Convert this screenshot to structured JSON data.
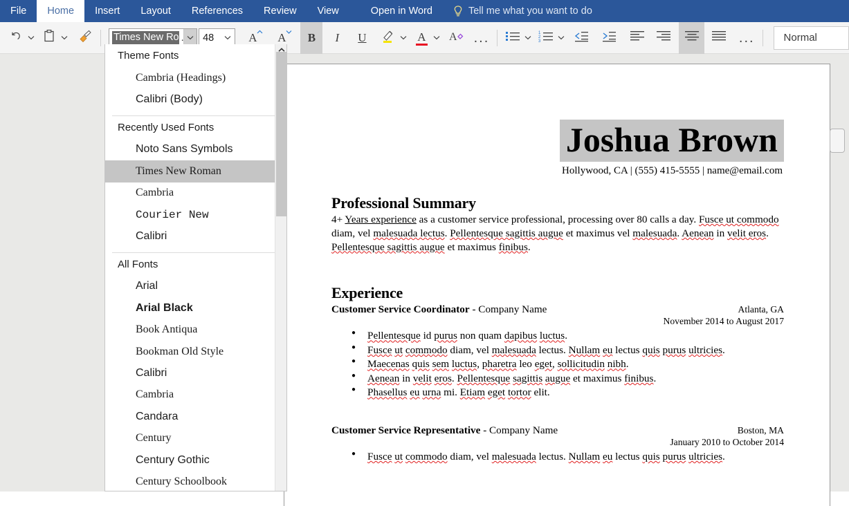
{
  "ribbon": {
    "tabs": [
      {
        "label": "File",
        "active": false
      },
      {
        "label": "Home",
        "active": true
      },
      {
        "label": "Insert",
        "active": false
      },
      {
        "label": "Layout",
        "active": false
      },
      {
        "label": "References",
        "active": false
      },
      {
        "label": "Review",
        "active": false
      },
      {
        "label": "View",
        "active": false
      },
      {
        "label": "Open in Word",
        "active": false
      }
    ],
    "tell_me": "Tell me what you want to do",
    "tell_me_icon": "lightbulb-icon"
  },
  "toolbar": {
    "undo_label": "undo-icon",
    "paste_label": "paste-icon",
    "format_painter_label": "format-painter-icon",
    "font_name": {
      "value_visible": "Times New Ro",
      "ellipsis": "...",
      "full_value": "Times New Roman"
    },
    "font_size": {
      "value": "48"
    },
    "grow_font": "A",
    "shrink_font": "A",
    "bold": "B",
    "italic": "I",
    "underline": "U",
    "highlight": "highlight-icon",
    "font_color": "A",
    "clear_formatting": "clear-formatting-icon",
    "more_font": "...",
    "bullets": "bullet-list-icon",
    "numbering": "numbered-list-icon",
    "decrease_indent": "decrease-indent-icon",
    "increase_indent": "increase-indent-icon",
    "align_left": "align-left-icon",
    "align_right": "align-right-icon",
    "align_center": "align-center-icon",
    "justify": "justify-icon",
    "more_paragraph": "...",
    "style_name": "Normal",
    "active_buttons": [
      "bold",
      "align_center"
    ]
  },
  "font_dropdown": {
    "groups": [
      {
        "heading": "Theme Fonts",
        "items": [
          {
            "label": "Cambria (Headings)",
            "style": "serif",
            "selected": false
          },
          {
            "label": "Calibri (Body)",
            "style": "sans",
            "selected": false
          }
        ]
      },
      {
        "heading": "Recently Used Fonts",
        "items": [
          {
            "label": "Noto Sans Symbols",
            "style": "sans",
            "selected": false
          },
          {
            "label": "Times New Roman",
            "style": "serif",
            "selected": true
          },
          {
            "label": "Cambria",
            "style": "serif",
            "selected": false
          },
          {
            "label": "Courier New",
            "style": "mono",
            "selected": false
          },
          {
            "label": "Calibri",
            "style": "sans",
            "selected": false
          }
        ]
      },
      {
        "heading": "All Fonts",
        "items": [
          {
            "label": "Arial",
            "style": "sans",
            "selected": false
          },
          {
            "label": "Arial Black",
            "style": "sans-bold",
            "selected": false
          },
          {
            "label": "Book Antiqua",
            "style": "serif",
            "selected": false
          },
          {
            "label": "Bookman Old Style",
            "style": "serif",
            "selected": false
          },
          {
            "label": "Calibri",
            "style": "sans",
            "selected": false
          },
          {
            "label": "Cambria",
            "style": "serif",
            "selected": false
          },
          {
            "label": "Candara",
            "style": "sans",
            "selected": false
          },
          {
            "label": "Century",
            "style": "serif",
            "selected": false
          },
          {
            "label": "Century Gothic",
            "style": "sans",
            "selected": false
          },
          {
            "label": "Century Schoolbook",
            "style": "serif",
            "selected": false
          }
        ]
      }
    ]
  },
  "document": {
    "name": "Joshua Brown",
    "contact": "Hollywood, CA | (555) 415-5555 | name@email.com",
    "sections": [
      {
        "heading": "Professional Summary",
        "paragraph_parts": [
          {
            "t": "4+ ",
            "s": "plain"
          },
          {
            "t": "Years experience",
            "s": "underline"
          },
          {
            "t": " as a customer service professional, processing over 80 calls a day. ",
            "s": "plain"
          },
          {
            "t": "Fusce ut commodo",
            "s": "spell"
          },
          {
            "t": " diam, vel ",
            "s": "plain"
          },
          {
            "t": "malesuada lectus",
            "s": "spell"
          },
          {
            "t": ". ",
            "s": "plain"
          },
          {
            "t": "Pellentesque sagittis augue",
            "s": "spell"
          },
          {
            "t": " et maximus vel ",
            "s": "plain"
          },
          {
            "t": "malesuada",
            "s": "spell"
          },
          {
            "t": ". ",
            "s": "plain"
          },
          {
            "t": "Aenean",
            "s": "spell"
          },
          {
            "t": " in ",
            "s": "plain"
          },
          {
            "t": "velit eros",
            "s": "spell"
          },
          {
            "t": ". ",
            "s": "plain"
          },
          {
            "t": "Pellentesque sagittis augue",
            "s": "spell"
          },
          {
            "t": " et maximus ",
            "s": "plain"
          },
          {
            "t": "finibus",
            "s": "spell"
          },
          {
            "t": ".",
            "s": "plain"
          }
        ]
      }
    ],
    "experience_heading": "Experience",
    "jobs": [
      {
        "title": "Customer Service Coordinator",
        "company": " - Company Name",
        "location": "Atlanta, GA",
        "dates": "November 2014 to August 2017",
        "bullets": [
          "Pellentesque id purus non quam dapibus luctus.",
          "Fusce ut commodo diam, vel malesuada lectus. Nullam eu lectus quis purus ultricies.",
          "Maecenas quis sem luctus, pharetra leo eget, sollicitudin nibh.",
          "Aenean in velit eros. Pellentesque sagittis augue et maximus finibus.",
          "Phasellus eu urna mi. Etiam eget tortor elit."
        ]
      },
      {
        "title": "Customer Service Representative",
        "company": " - Company Name",
        "location": "Boston, MA",
        "dates": "January 2010 to October 2014",
        "bullets": [
          "Fusce ut commodo diam, vel malesuada lectus. Nullam eu lectus quis purus ultricies."
        ]
      }
    ]
  },
  "colors": {
    "ribbon_blue": "#2b579a",
    "toolbar_bg": "#f4f4f4",
    "active_button_bg": "#d0d0d0",
    "selection_gray": "#c5c5c5",
    "page_bg_gray": "#e9e9e7",
    "spellcheck_red": "#e02020",
    "highlight_yellow": "#ffe600",
    "font_color_red": "#e81123",
    "list_blue": "#2b7cd3"
  }
}
